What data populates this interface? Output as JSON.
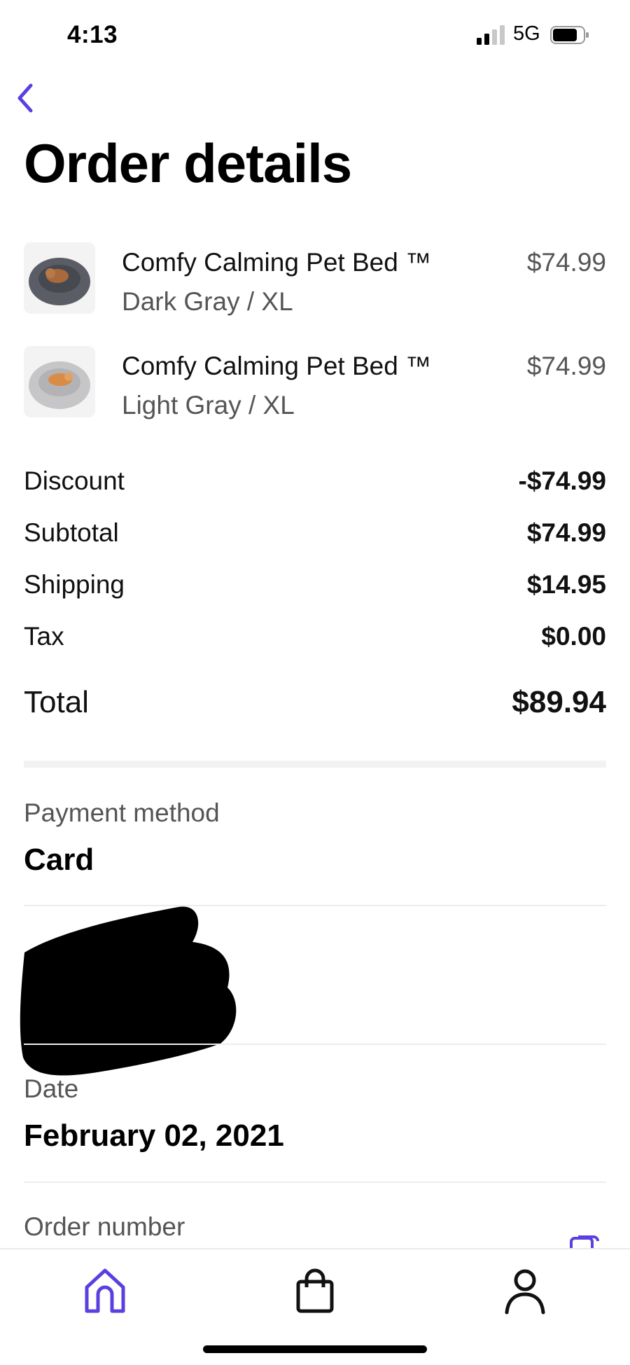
{
  "status_bar": {
    "time": "4:13",
    "network": "5G"
  },
  "header": {
    "title": "Order details"
  },
  "items": [
    {
      "name": "Comfy Calming Pet Bed ™",
      "variant": "Dark Gray / XL",
      "price": "$74.99",
      "thumb_color": "#5a5d66"
    },
    {
      "name": "Comfy Calming Pet Bed ™",
      "variant": "Light Gray / XL",
      "price": "$74.99",
      "thumb_color": "#c6c6c8"
    }
  ],
  "summary": {
    "discount": {
      "label": "Discount",
      "value": "-$74.99"
    },
    "subtotal": {
      "label": "Subtotal",
      "value": "$74.99"
    },
    "shipping": {
      "label": "Shipping",
      "value": "$14.95"
    },
    "tax": {
      "label": "Tax",
      "value": "$0.00"
    },
    "total": {
      "label": "Total",
      "value": "$89.94"
    }
  },
  "details": {
    "payment_method": {
      "label": "Payment method",
      "value": "Card"
    },
    "date": {
      "label": "Date",
      "value": "February 02, 2021"
    },
    "order_number": {
      "label": "Order number"
    }
  },
  "tab_bar": {
    "tabs": [
      "home-icon",
      "shopping-bag-icon",
      "profile-icon"
    ],
    "active_color": "#5b3fe0",
    "inactive_color": "#111111"
  },
  "colors": {
    "accent": "#5b3fe0"
  }
}
